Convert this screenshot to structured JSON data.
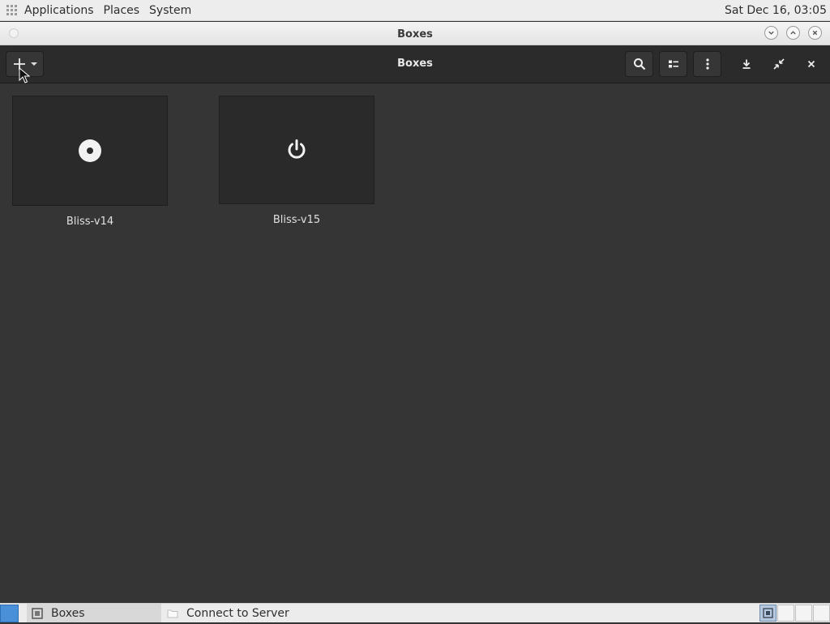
{
  "top_panel": {
    "menus": [
      "Applications",
      "Places",
      "System"
    ],
    "clock": "Sat Dec 16, 03:05"
  },
  "window": {
    "title": "Boxes"
  },
  "headerbar": {
    "title": "Boxes",
    "icons": [
      "add-icon",
      "dropdown-arrow-icon",
      "search-icon",
      "list-view-icon",
      "menu-dots-icon",
      "download-icon",
      "unfullscreen-icon",
      "close-icon"
    ]
  },
  "boxes": [
    {
      "name": "Bliss-v14",
      "state_icon": "disc-media-icon"
    },
    {
      "name": "Bliss-v15",
      "state_icon": "power-icon"
    }
  ],
  "taskbar": {
    "tasks": [
      {
        "label": "Boxes",
        "icon": "boxes-app-icon",
        "active": true
      },
      {
        "label": "Connect to Server",
        "icon": "folder-icon",
        "active": false
      }
    ],
    "workspaces": 4
  }
}
